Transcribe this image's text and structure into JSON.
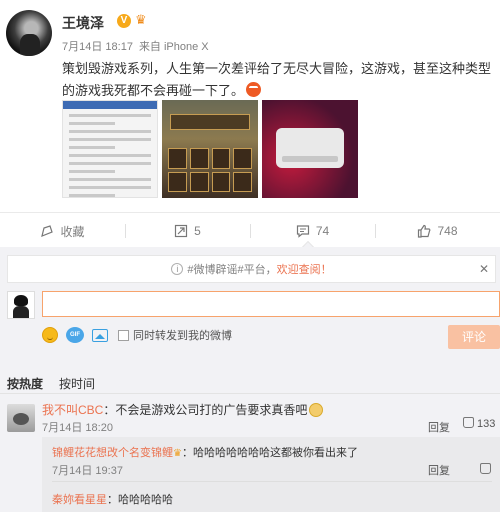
{
  "post": {
    "author": "王境泽",
    "badge": "V",
    "date": "7月14日 18:17",
    "source": "来自 iPhone X",
    "content": "策划毁游戏系列，人生第一次差评给了无尽大冒险，这游戏，甚至这种类型的游戏我死都不会再碰一下了。"
  },
  "actions": {
    "favorite": "收藏",
    "repost": "5",
    "comment": "74",
    "like": "748"
  },
  "notice": {
    "prefix": "#微博辟谣#平台，",
    "link": "欢迎查阅！"
  },
  "composer": {
    "checkbox_label": "同时转发到我的微博",
    "submit": "评论"
  },
  "tabs": [
    "按热度",
    "按时间"
  ],
  "comments": [
    {
      "user": "我不叫CBC",
      "text": "：不会是游戏公司打的广告要求真香吧",
      "time": "7月14日 18:20",
      "reply": "回复",
      "likes": "133",
      "replies": [
        {
          "user": "锦鲤花花想改个名变锦鲤",
          "text": "：哈哈哈哈哈哈哈这都被你看出来了",
          "time": "7月14日 19:37",
          "reply": "回复"
        },
        {
          "user": "秦妳看星星",
          "text": "：哈哈哈哈哈"
        }
      ]
    }
  ]
}
